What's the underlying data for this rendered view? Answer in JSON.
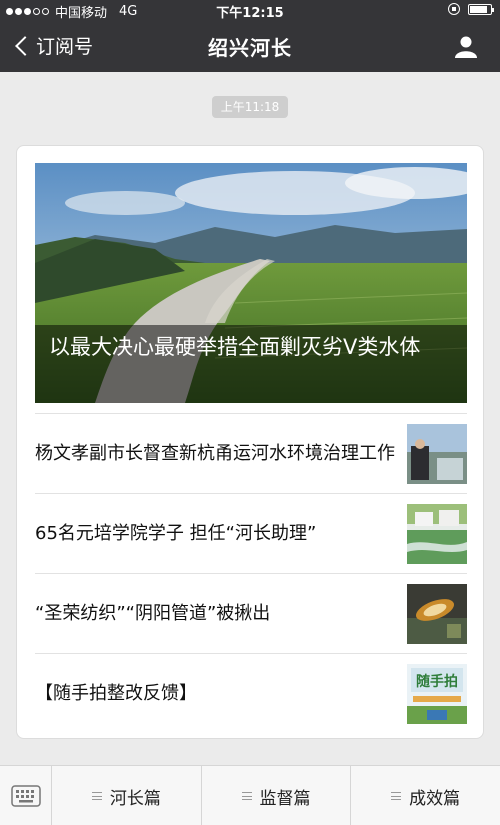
{
  "status": {
    "carrier": "中国移动",
    "network": "4G",
    "time": "下午12:15",
    "battery_level": 0.85
  },
  "nav": {
    "back_label": "订阅号",
    "title": "绍兴河长"
  },
  "message": {
    "timestamp": "上午11:18"
  },
  "articles": {
    "hero": {
      "title": "以最大决心最硬举措全面剿灭劣Ⅴ类水体"
    },
    "items": [
      {
        "title": "杨文孝副市长督查新杭甬运河水环境治理工作"
      },
      {
        "title": "65名元培学院学子 担任“河长助理”"
      },
      {
        "title": "“圣荣纺织”“阴阳管道”被揪出"
      },
      {
        "title": "【随手拍整改反馈】"
      }
    ]
  },
  "menu": {
    "items": [
      "河长篇",
      "监督篇",
      "成效篇"
    ]
  },
  "colors": {
    "nav_bg": "#353538",
    "page_bg": "#ebebeb"
  }
}
